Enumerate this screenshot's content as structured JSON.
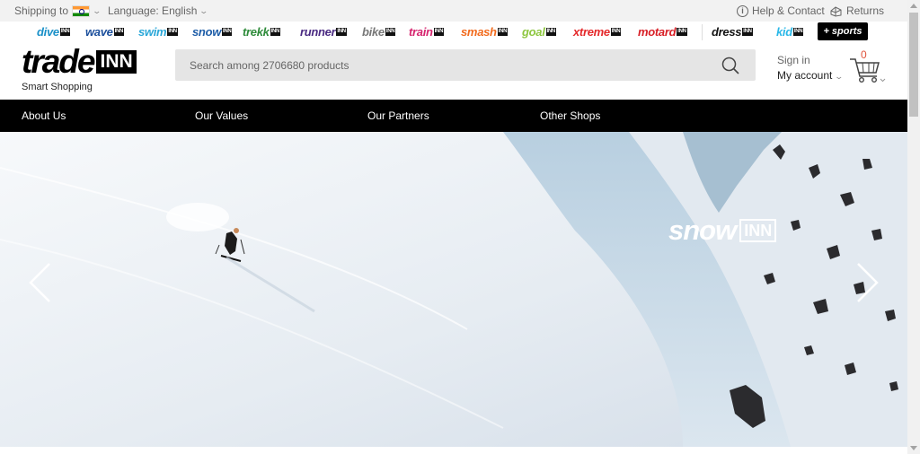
{
  "topbar": {
    "shipping_label": "Shipping to",
    "language_label": "Language: English",
    "help_label": "Help & Contact",
    "returns_label": "Returns"
  },
  "shops": [
    {
      "name": "dive",
      "color": "#1a90c8"
    },
    {
      "name": "wave",
      "color": "#1c4f9c"
    },
    {
      "name": "swim",
      "color": "#2aa7d8"
    },
    {
      "name": "snow",
      "color": "#1f5ea8"
    },
    {
      "name": "trekk",
      "color": "#2e8b3a"
    },
    {
      "name": "runner",
      "color": "#4a2a82"
    },
    {
      "name": "bike",
      "color": "#777777"
    },
    {
      "name": "train",
      "color": "#d6246e"
    },
    {
      "name": "smash",
      "color": "#f26b1d"
    },
    {
      "name": "goal",
      "color": "#8dc63f"
    },
    {
      "name": "xtreme",
      "color": "#e4282a"
    },
    {
      "name": "motard",
      "color": "#d81f26"
    },
    {
      "name": "dress",
      "color": "#111111"
    },
    {
      "name": "kid",
      "color": "#2ab8e8"
    }
  ],
  "shop_inn_label": "INN",
  "sports_button": "+ sports",
  "header": {
    "logo_text": "trade",
    "logo_inn": "INN",
    "tagline": "Smart Shopping",
    "search_placeholder": "Search among 2706680 products",
    "signin_label": "Sign in",
    "account_label": "My account",
    "cart_count": "0"
  },
  "nav": {
    "items": [
      "About Us",
      "Our Values",
      "Our Partners",
      "Other Shops"
    ]
  },
  "hero": {
    "brand_main": "snow",
    "brand_inn": "INN"
  }
}
